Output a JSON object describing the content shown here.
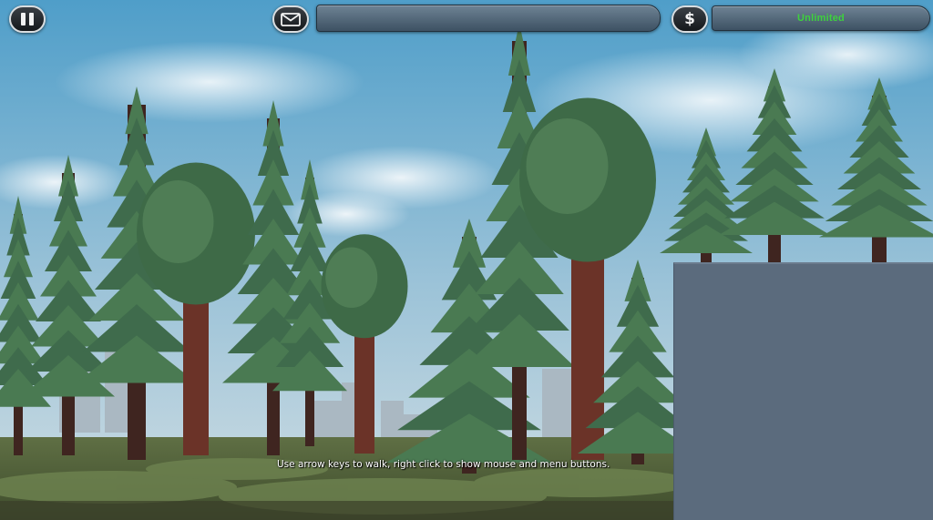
{
  "hud": {
    "pause_icon": "pause-icon",
    "mail_icon": "envelope-icon",
    "money_icon": "dollar-icon",
    "money_symbol": "$",
    "money_value": "Unlimited",
    "message_text": ""
  },
  "hint": {
    "text": "Use arrow keys to walk, right click to show mouse and menu buttons."
  },
  "colors": {
    "money_text": "#3ed13e",
    "panel": "#5b6b7d",
    "sky_top": "#4f9ec9",
    "ground": "#4d5e3a"
  }
}
